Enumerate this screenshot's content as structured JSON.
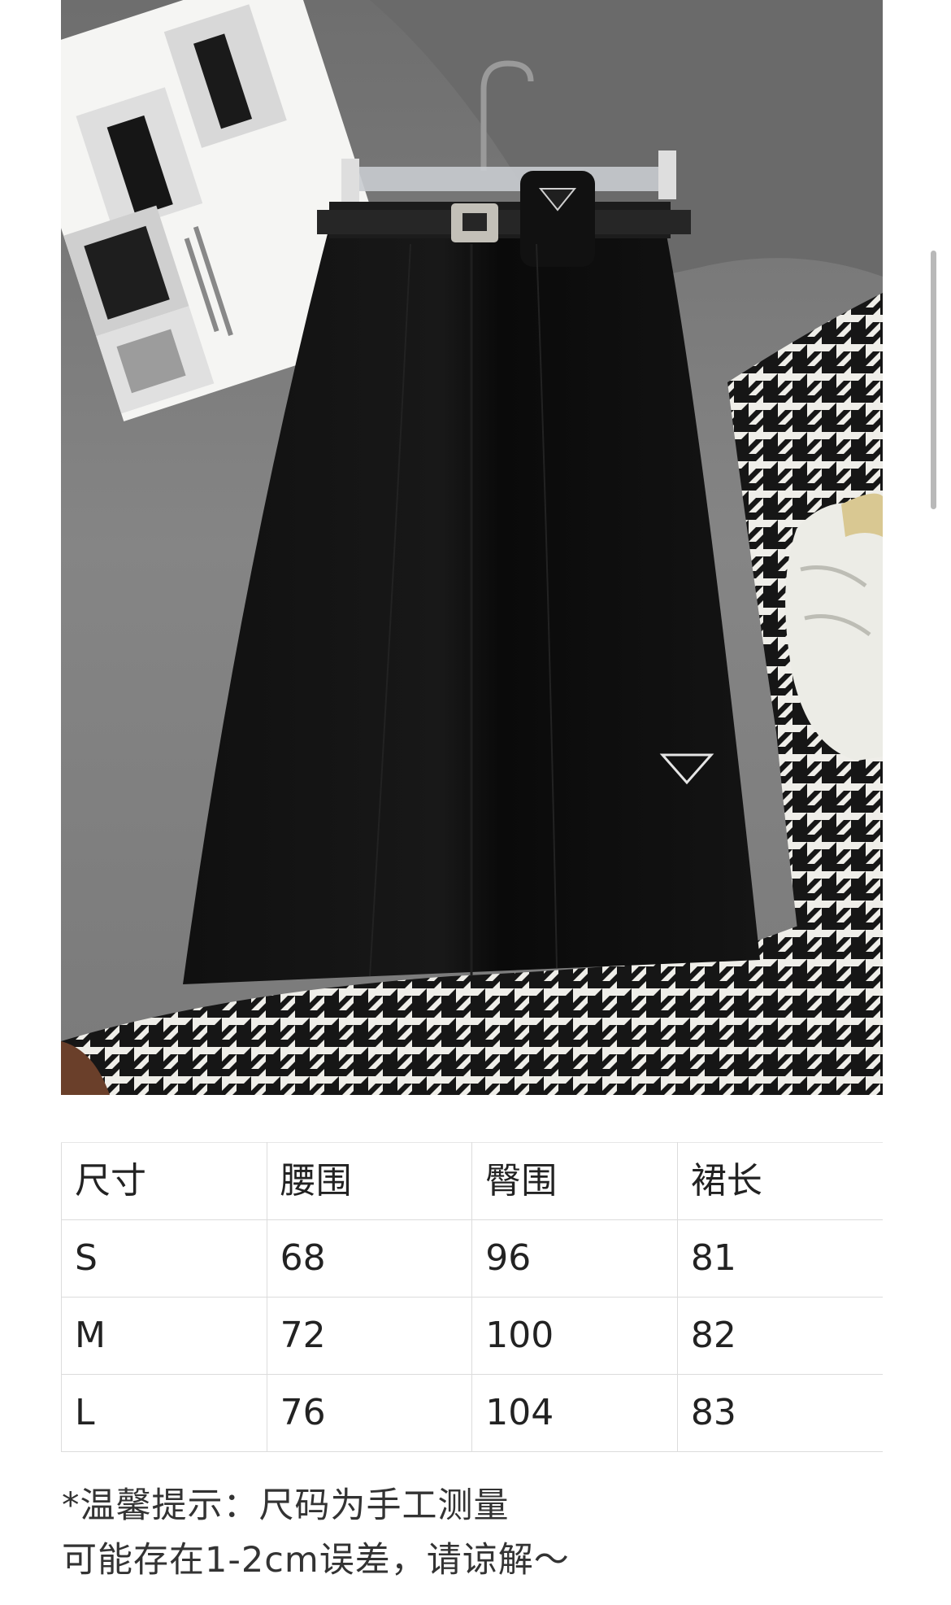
{
  "photo": {
    "icon": "product-photo-skirt",
    "colors": {
      "couch": "#7b7b7b",
      "skirt": "#0c0c0c",
      "houndstooth_light": "#efeee9",
      "houndstooth_dark": "#161616"
    }
  },
  "size_table": {
    "headers": [
      "尺寸",
      "腰围",
      "臀围",
      "裙长"
    ],
    "rows": [
      [
        "S",
        "68",
        "96",
        "81"
      ],
      [
        "M",
        "72",
        "100",
        "82"
      ],
      [
        "L",
        "76",
        "104",
        "83"
      ]
    ]
  },
  "note": {
    "line1": "*温馨提示：尺码为手工测量",
    "line2": "可能存在1-2cm误差，请谅解～"
  }
}
